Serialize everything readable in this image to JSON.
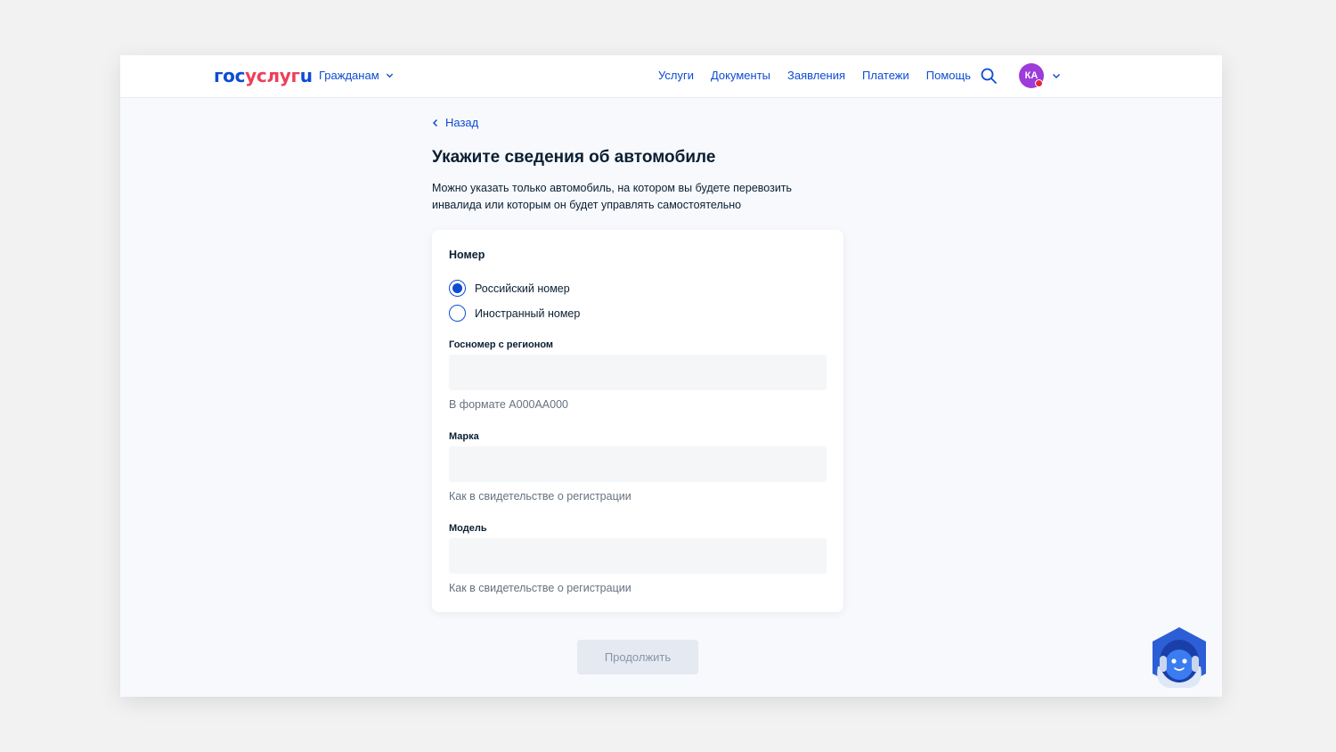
{
  "header": {
    "logo": {
      "part1": "гос",
      "part2": "услуг",
      "part3": "u"
    },
    "audience_label": "Гражданам",
    "nav": [
      "Услуги",
      "Документы",
      "Заявления",
      "Платежи",
      "Помощь"
    ],
    "user_initials": "КА"
  },
  "page": {
    "back_label": "Назад",
    "title": "Укажите сведения об автомобиле",
    "description": "Можно указать только автомобиль, на котором вы будете перевозить инвалида или которым он будет управлять самостоятельно"
  },
  "form": {
    "number_label": "Номер",
    "radio_options": [
      {
        "label": "Российский номер",
        "selected": true
      },
      {
        "label": "Иностранный номер",
        "selected": false
      }
    ],
    "plate": {
      "label": "Госномер с регионом",
      "value": "",
      "hint": "В формате А000АА000"
    },
    "brand": {
      "label": "Марка",
      "value": "",
      "hint": "Как в свидетельстве о регистрации"
    },
    "model": {
      "label": "Модель",
      "value": "",
      "hint": "Как в свидетельстве о регистрации"
    }
  },
  "actions": {
    "continue_label": "Продолжить"
  },
  "colors": {
    "accent": "#0d4cd3",
    "brand_red": "#ee3f58",
    "avatar": "#9d3bdb",
    "disabled_bg": "#e4e9f2"
  },
  "icons": [
    "chevron-down-icon",
    "search-icon",
    "chevron-left-icon",
    "assistant-robot-icon"
  ]
}
